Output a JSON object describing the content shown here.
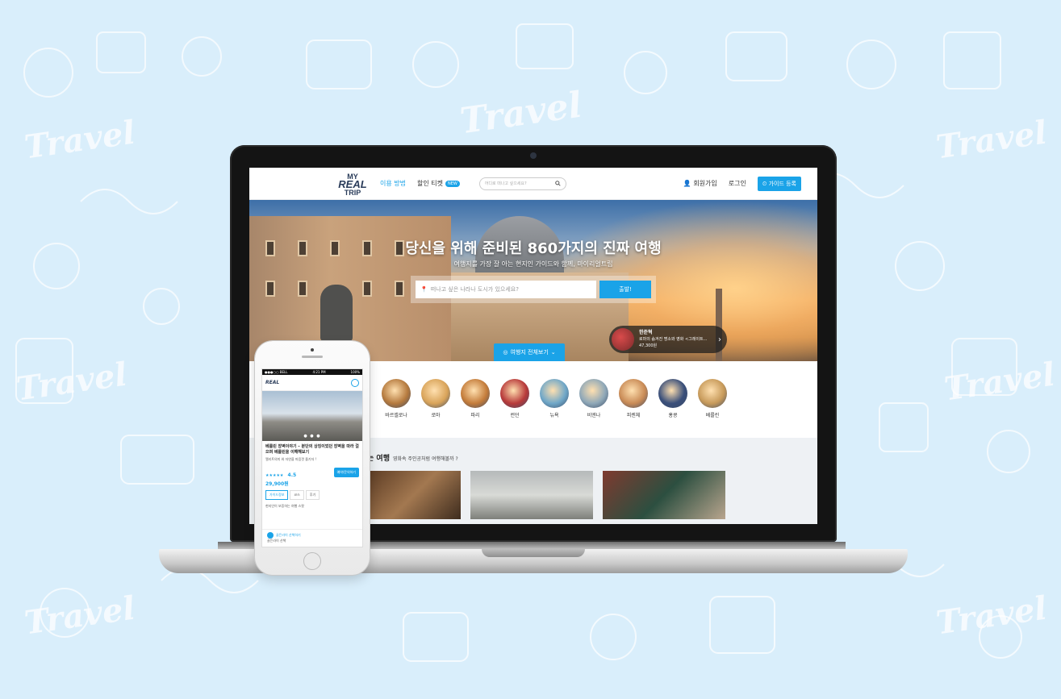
{
  "header": {
    "logo_small": "MY",
    "logo_big": "REAL",
    "logo_bottom": "TRIP",
    "nav_how": "이용 방법",
    "nav_ticket": "할인 티켓",
    "new_badge": "NEW",
    "search_placeholder": "어디로 떠나고 싶으세요?",
    "signup": "회원가입",
    "login": "로그인",
    "guide_register": "가이드 등록"
  },
  "hero": {
    "title": "당신을 위해 준비된 860가지의 진짜 여행",
    "subtitle": "여행지를 가장 잘 아는 현지인 가이드와 함께, 마이리얼트립",
    "search_placeholder": "떠나고 싶은 나라나 도시가 있으세요?",
    "search_button": "출발!",
    "all_destinations": "여행지 전체보기",
    "promo_name": "한준혁",
    "promo_desc": "로마의 숨겨진 명소와 영화 <그레이트…",
    "promo_price": "47,300원"
  },
  "cities": [
    {
      "label": "바르셀로나",
      "color": "#b57a3e"
    },
    {
      "label": "로마",
      "color": "#d9a45a"
    },
    {
      "label": "파리",
      "color": "#c47c3a"
    },
    {
      "label": "런던",
      "color": "#b83a3a"
    },
    {
      "label": "뉴욕",
      "color": "#6fa7c8"
    },
    {
      "label": "비엔나",
      "color": "#8fa8b8"
    },
    {
      "label": "피렌체",
      "color": "#c98b56"
    },
    {
      "label": "홍콩",
      "color": "#3a4f7a"
    },
    {
      "label": "베를린",
      "color": "#c79a5a"
    }
  ],
  "section": {
    "title": "는 여행",
    "subtitle": "영화속 주인공처럼 여행해볼까 ?"
  },
  "phone": {
    "status_left": "●●●○○ BELL",
    "status_time": "4:21 PM",
    "status_right": "100%",
    "logo": "REAL",
    "dots": "● ● ●",
    "title": "베를린 장벽이야기 – 분단의 상징이었던 장벽을 따라 걸으며 베를린을 이해해보기",
    "desc": "엘리트의미 와 자연을 마음껏 즐기자 !",
    "stars": "★★★★★",
    "rating": "4.5",
    "price": "29,900원",
    "book_button": "예약/문의하기",
    "tabs": [
      "가이드정보",
      "코스",
      "후기"
    ],
    "list": "현지인이 보증하는 여행 스팟",
    "bottom_label": "골든라이 산책하기",
    "bottom_sub": "골든라이 산책"
  },
  "colors": {
    "accent": "#1aa3e8",
    "background": "#d9eefb"
  }
}
